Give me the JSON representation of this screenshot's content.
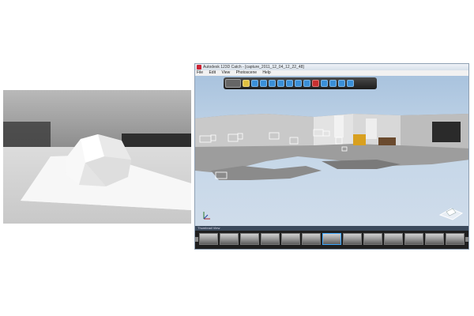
{
  "window": {
    "title": "Autodesk 123D Catch - [capture_2011_12_04_12_22_48]",
    "menu": [
      "File",
      "Edit",
      "View",
      "Photoscene",
      "Help"
    ]
  },
  "toolbar": {
    "tools": [
      {
        "icon": "capture-icon",
        "color": "#666666"
      },
      {
        "icon": "orbit-icon",
        "color": "#e0c040"
      },
      {
        "icon": "pan-icon",
        "color": "#3a8fd8"
      },
      {
        "icon": "camera-icon",
        "color": "#3a8fd8"
      },
      {
        "icon": "zoom-icon",
        "color": "#3a8fd8"
      },
      {
        "icon": "fit-icon",
        "color": "#3a8fd8"
      },
      {
        "icon": "select-icon",
        "color": "#3a8fd8"
      },
      {
        "icon": "mesh-icon",
        "color": "#3a8fd8"
      },
      {
        "icon": "export-icon",
        "color": "#3a8fd8"
      },
      {
        "icon": "video-icon",
        "color": "#c83030"
      },
      {
        "icon": "ruler-icon",
        "color": "#3a8fd8"
      },
      {
        "icon": "paint-icon",
        "color": "#3a8fd8"
      },
      {
        "icon": "settings-icon",
        "color": "#3a8fd8"
      },
      {
        "icon": "share-icon",
        "color": "#3a8fd8"
      }
    ]
  },
  "filmstrip": {
    "header": "Thumbnail View",
    "thumbnail_count": 13,
    "active_index": 6
  },
  "colors": {
    "viewport_sky": "#c4d6e8",
    "toolbar_bg": "#1c1c1c",
    "filmstrip_bg": "#1f1f1f",
    "accent": "#3fa9ff"
  }
}
